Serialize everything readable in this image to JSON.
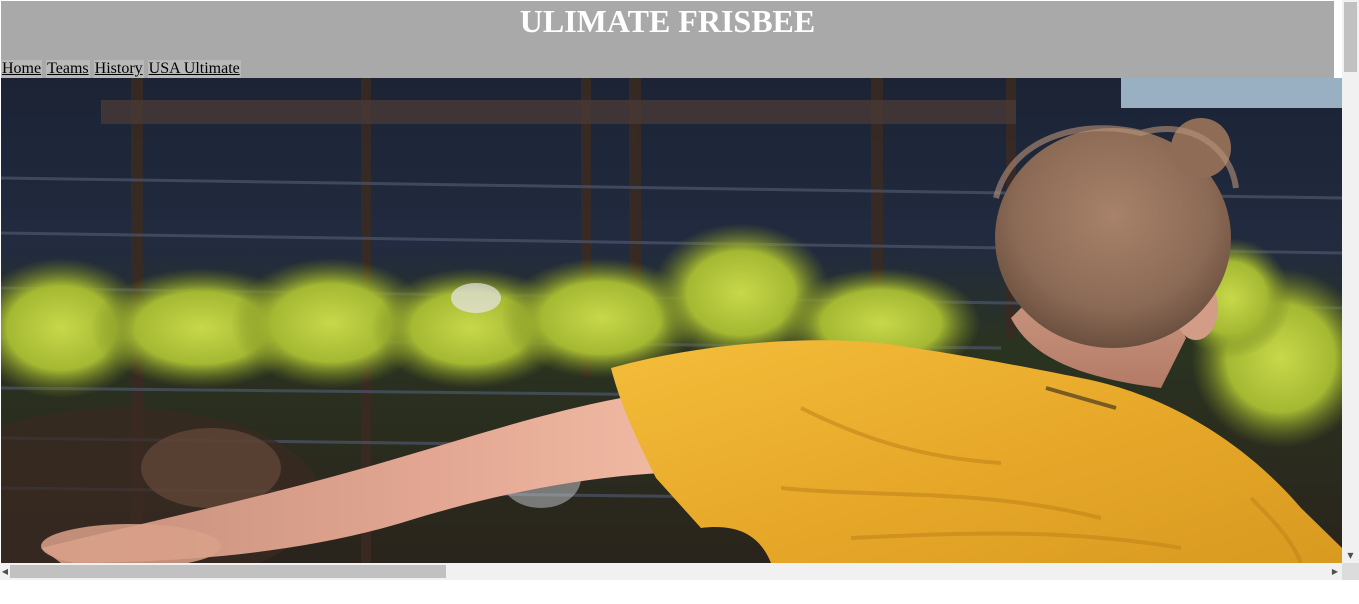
{
  "header": {
    "title": "ULIMATE FRISBEE",
    "background_color": "#a9a9a9",
    "title_color": "#ffffff"
  },
  "nav": {
    "items": [
      {
        "label": "Home"
      },
      {
        "label": "Teams"
      },
      {
        "label": "History"
      },
      {
        "label": "USA Ultimate"
      }
    ]
  },
  "hero": {
    "description_icon": "frisbee-player-photo",
    "shirt_color": "#f0b22e"
  },
  "scrollbars": {
    "vertical_icon": "chevron-down-icon",
    "horizontal_left_icon": "chevron-left-icon",
    "horizontal_right_icon": "chevron-right-icon",
    "arrow_down_glyph": "▼",
    "arrow_left_glyph": "◀",
    "arrow_right_glyph": "▶"
  }
}
